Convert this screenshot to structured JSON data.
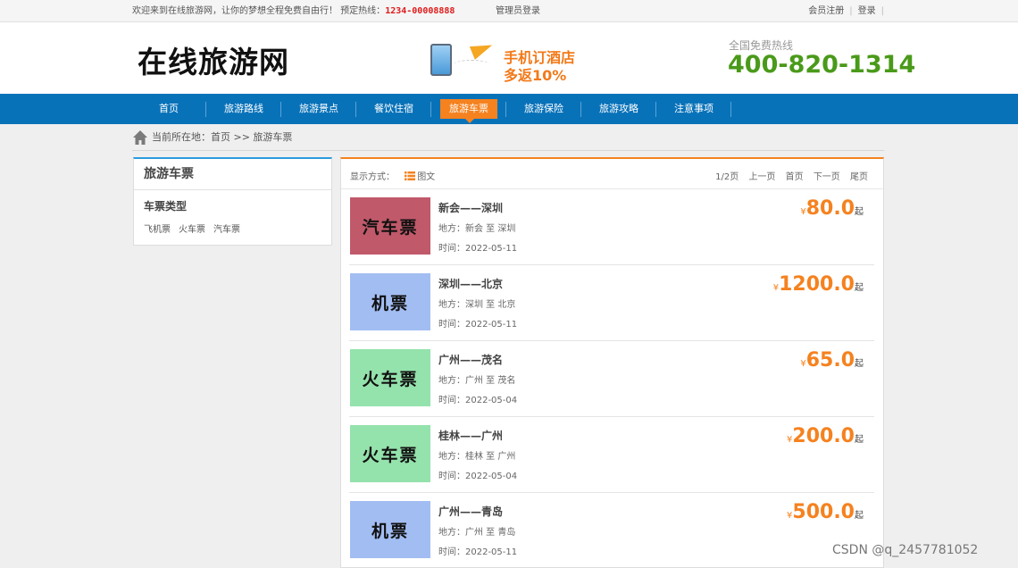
{
  "topbar": {
    "welcome": "欢迎来到在线旅游网，让你的梦想全程免费自由行！ 预定热线：",
    "hotline": "1234-00008888",
    "admin_login": "管理员登录",
    "register": "会员注册",
    "login": "登录",
    "separator": "|"
  },
  "header": {
    "logo": "在线旅游网",
    "promo_line1": "手机订酒店",
    "promo_line2": "多返10%",
    "hotline_label": "全国免费热线",
    "hotline_number": "400-820-1314"
  },
  "nav": {
    "items": [
      {
        "label": "首页"
      },
      {
        "label": "旅游路线"
      },
      {
        "label": "旅游景点"
      },
      {
        "label": "餐饮住宿"
      },
      {
        "label": "旅游车票"
      },
      {
        "label": "旅游保险"
      },
      {
        "label": "旅游攻略"
      },
      {
        "label": "注意事项"
      }
    ],
    "active_index": 4
  },
  "breadcrumb": {
    "text": "当前所在地：首页 >> 旅游车票"
  },
  "sidebar": {
    "title": "旅游车票",
    "subtitle": "车票类型",
    "links": [
      "飞机票",
      "火车票",
      "汽车票"
    ]
  },
  "list_header": {
    "mode_label": "显示方式：",
    "mode_value": "图文",
    "page_info": "1/2页",
    "prev": "上一页",
    "first": "首页",
    "next": "下一页",
    "last": "尾页"
  },
  "items": [
    {
      "thumb": "汽车票",
      "thumb_color": "#c0596a",
      "name": "新会——深圳",
      "place": "地方：新会 至 深圳",
      "date": "时间：2022-05-11",
      "currency": "¥",
      "price": "80.0",
      "suffix": "起"
    },
    {
      "thumb": "机票",
      "thumb_color": "#a2bdf2",
      "name": "深圳——北京",
      "place": "地方：深圳 至 北京",
      "date": "时间：2022-05-11",
      "currency": "¥",
      "price": "1200.0",
      "suffix": "起"
    },
    {
      "thumb": "火车票",
      "thumb_color": "#94e2ac",
      "name": "广州——茂名",
      "place": "地方：广州 至 茂名",
      "date": "时间：2022-05-04",
      "currency": "¥",
      "price": "65.0",
      "suffix": "起"
    },
    {
      "thumb": "火车票",
      "thumb_color": "#94e2ac",
      "name": "桂林——广州",
      "place": "地方：桂林 至 广州",
      "date": "时间：2022-05-04",
      "currency": "¥",
      "price": "200.0",
      "suffix": "起"
    },
    {
      "thumb": "机票",
      "thumb_color": "#a2bdf2",
      "name": "广州——青岛",
      "place": "地方：广州 至 青岛",
      "date": "时间：2022-05-11",
      "currency": "¥",
      "price": "500.0",
      "suffix": "起"
    }
  ],
  "watermark": "CSDN @q_2457781052",
  "colors": {
    "nav_bg": "#0872b9",
    "accent_orange": "#f5821f",
    "hotline_green": "#4a9a1a",
    "sidebar_accent": "#2a9ce0"
  }
}
